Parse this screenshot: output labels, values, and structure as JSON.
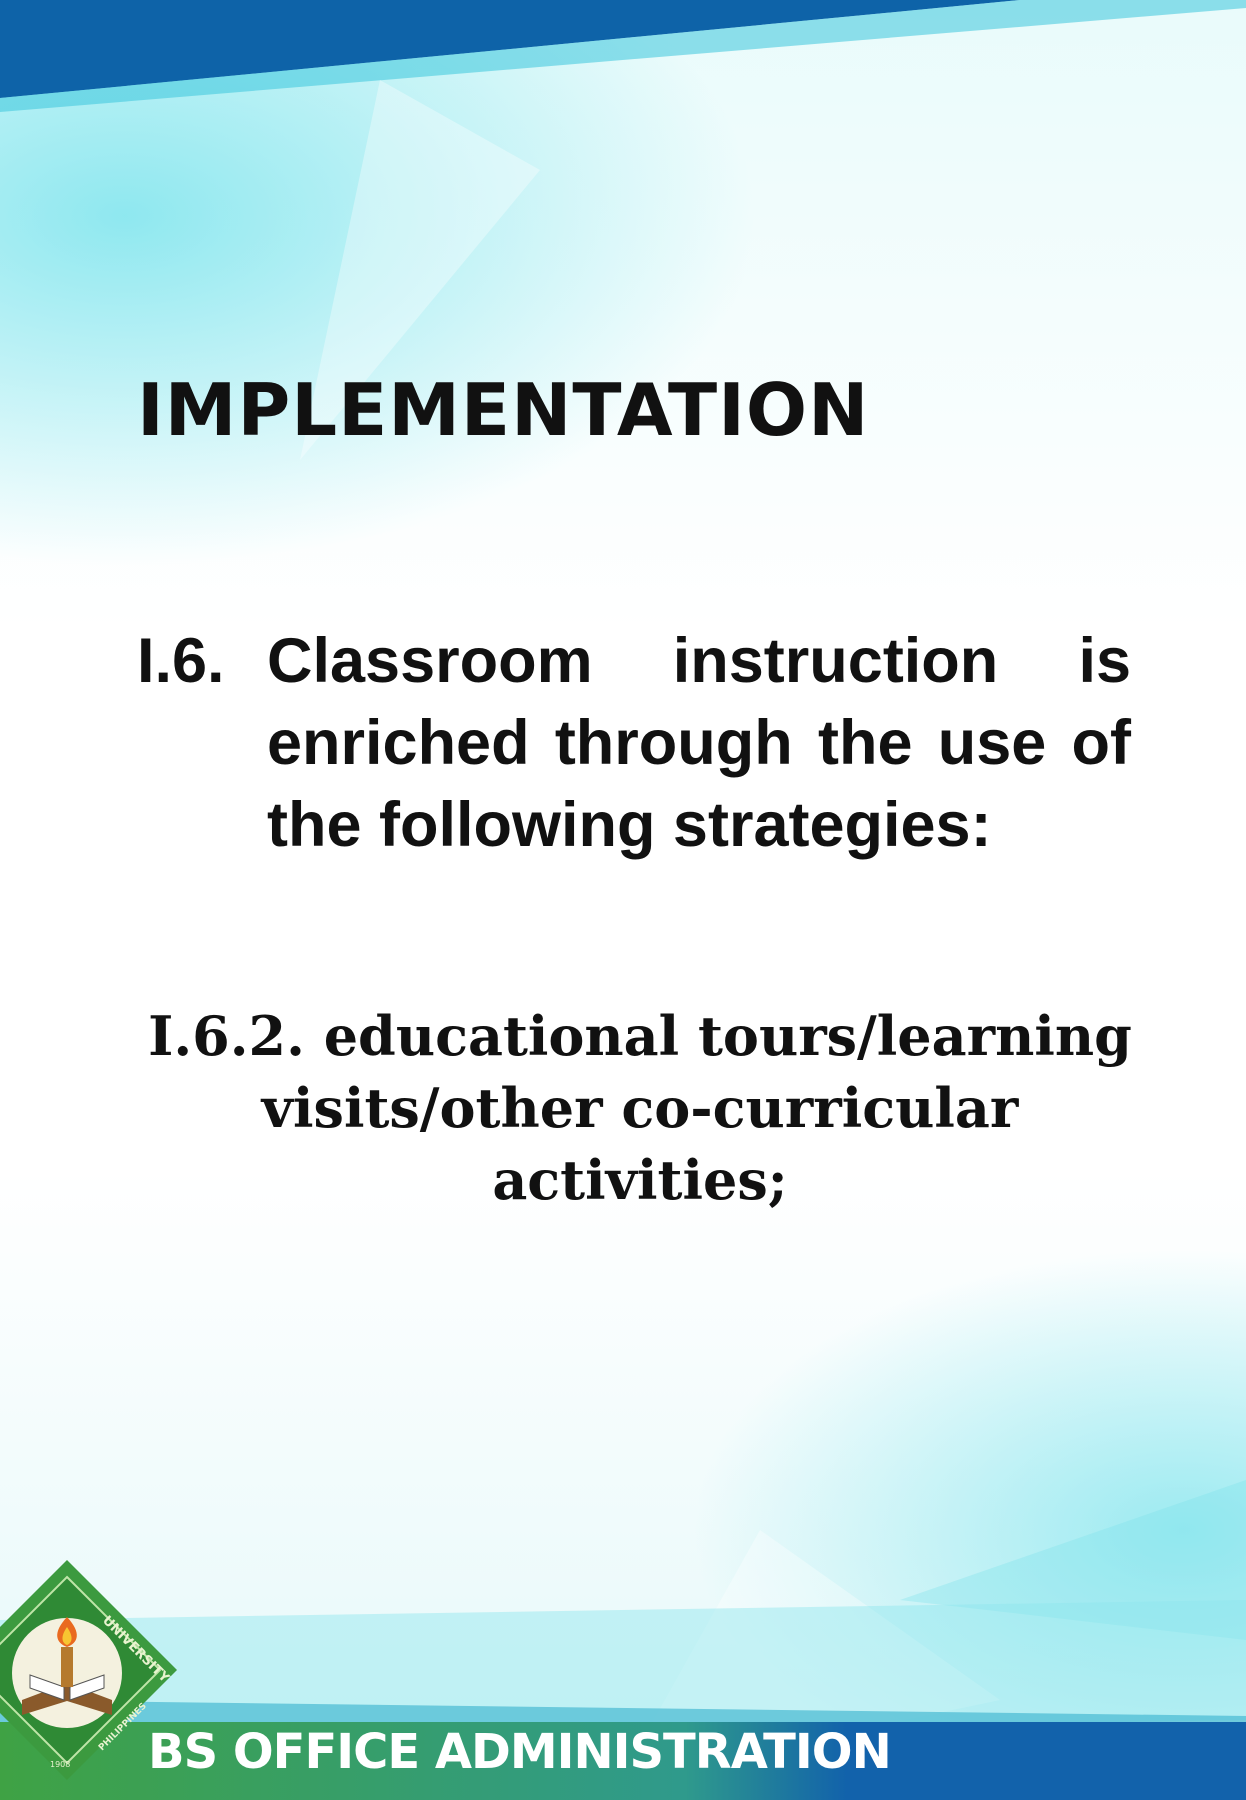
{
  "slide": {
    "title": "IMPLEMENTATION",
    "item": {
      "number": "I.6.",
      "text": "Classroom instruction is enriched through the use of the following strategies:"
    },
    "subitem": {
      "text": "I.6.2. educational tours/learning visits/other co-curricular activities;"
    }
  },
  "footer": {
    "program": "BS OFFICE ADMINISTRATION",
    "seal_text": [
      "UNIVERSITY",
      "PHILIPPINES",
      "1908"
    ]
  },
  "colors": {
    "top_band": "#0e63a8",
    "footer_green": "#3fa244",
    "footer_blue": "#1262ab",
    "accent_cyan": "#6fe0ea"
  }
}
